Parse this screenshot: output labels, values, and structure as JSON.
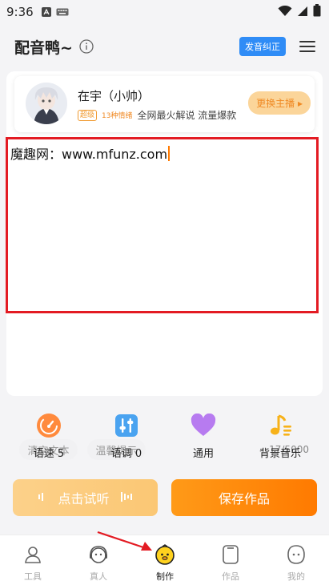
{
  "status_bar": {
    "time": "9:36"
  },
  "header": {
    "title": "配音鸭~",
    "pronunciation_badge": "发音纠正"
  },
  "anchor": {
    "name": "在宇（小帅）",
    "level_badge": "超级",
    "emotion_badge": "13种情绪",
    "description": "全网最火解说 流量爆款",
    "change_button": "更换主播"
  },
  "editor": {
    "text": "魔趣网：www.mfunz.com"
  },
  "editor_actions": {
    "clear_label": "清空文本",
    "tips_label": "温馨提示",
    "char_count": "17/5000"
  },
  "controls": [
    {
      "label": "语速 5",
      "icon": "speedometer-icon"
    },
    {
      "label": "语调 0",
      "icon": "equalizer-icon"
    },
    {
      "label": "通用",
      "icon": "heart-icon"
    },
    {
      "label": "背景音乐",
      "icon": "music-note-icon"
    }
  ],
  "actions": {
    "preview_label": "点击试听",
    "save_label": "保存作品"
  },
  "bottom_nav": [
    {
      "label": "工具",
      "icon": "person-icon"
    },
    {
      "label": "真人",
      "icon": "headphones-face-icon"
    },
    {
      "label": "制作",
      "icon": "duck-face-icon",
      "active": true
    },
    {
      "label": "作品",
      "icon": "works-icon"
    },
    {
      "label": "我的",
      "icon": "profile-face-icon"
    }
  ],
  "colors": {
    "accent": "#ff7a00",
    "highlight_border": "#e31b23",
    "badge_blue": "#2f8cf6",
    "nav_active": "#ffd21f"
  }
}
